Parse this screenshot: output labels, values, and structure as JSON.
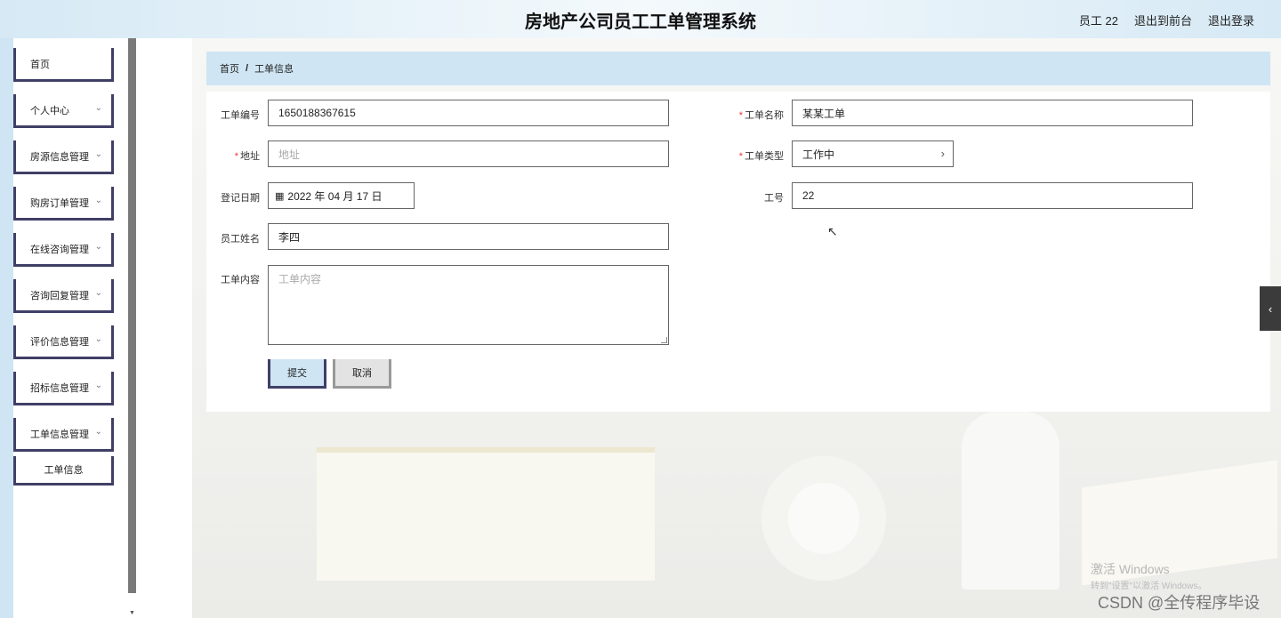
{
  "header": {
    "title": "房地产公司员工工单管理系统",
    "user": "员工 22",
    "to_front": "退出到前台",
    "logout": "退出登录"
  },
  "sidebar": {
    "items": [
      {
        "label": "首页",
        "has_arrow": false
      },
      {
        "label": "个人中心",
        "has_arrow": true
      },
      {
        "label": "房源信息管理",
        "has_arrow": true
      },
      {
        "label": "购房订单管理",
        "has_arrow": true
      },
      {
        "label": "在线咨询管理",
        "has_arrow": true
      },
      {
        "label": "咨询回复管理",
        "has_arrow": true
      },
      {
        "label": "评价信息管理",
        "has_arrow": true
      },
      {
        "label": "招标信息管理",
        "has_arrow": true
      },
      {
        "label": "工单信息管理",
        "has_arrow": true
      }
    ],
    "sub_item": "工单信息",
    "arrow_icon": "chevron-down-icon"
  },
  "breadcrumb": {
    "home": "首页",
    "separator": "/",
    "current": "工单信息"
  },
  "form": {
    "order_no": {
      "label": "工单编号",
      "value": "1650188367615"
    },
    "order_name": {
      "label": "工单名称",
      "value": "某某工单",
      "required": true
    },
    "address": {
      "label": "地址",
      "placeholder": "地址",
      "required": true
    },
    "order_type": {
      "label": "工单类型",
      "value": "工作中",
      "required": true
    },
    "reg_date": {
      "label": "登记日期",
      "value": "2022 年 04 月 17 日"
    },
    "job_no": {
      "label": "工号",
      "value": "22"
    },
    "staff_name": {
      "label": "员工姓名",
      "value": "李四"
    },
    "content": {
      "label": "工单内容",
      "placeholder": "工单内容"
    },
    "required_mark": "*"
  },
  "buttons": {
    "submit": "提交",
    "cancel": "取消"
  },
  "watermark": {
    "activate_title": "激活 Windows",
    "activate_sub": "转到\"设置\"以激活 Windows。",
    "csdn": "CSDN @全传程序毕设"
  },
  "colors": {
    "accent_light_blue": "#cfe5f3",
    "border_dark": "#3f3f66",
    "required_red": "#e33"
  }
}
